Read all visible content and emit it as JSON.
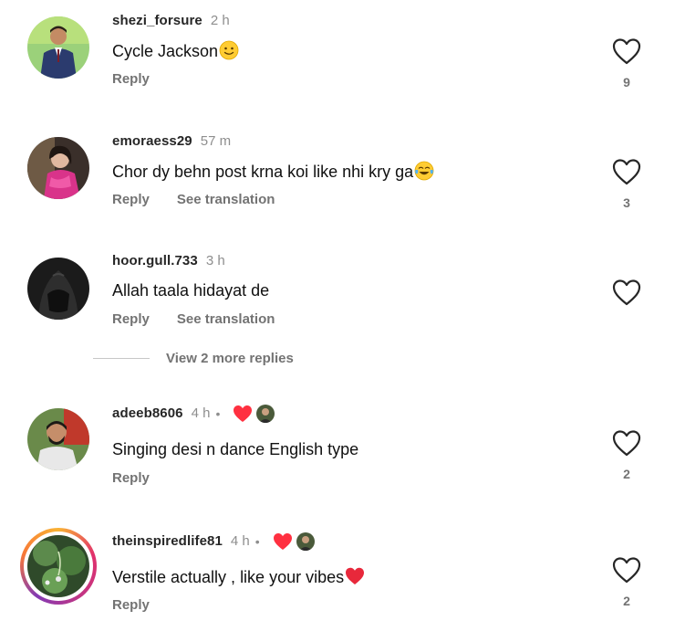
{
  "comments": [
    {
      "username": "shezi_forsure",
      "time": "2 h",
      "text": "Cycle Jackson",
      "emoji": "slightly-smiling-face",
      "reply_label": "Reply",
      "translation_label": "",
      "likes": "9",
      "avatar": "man-in-suit-avatar"
    },
    {
      "username": "emoraess29",
      "time": "57 m",
      "text": "Chor dy behn post krna koi like nhi kry ga",
      "emoji": "tears-of-joy-face",
      "reply_label": "Reply",
      "translation_label": "See translation",
      "likes": "3",
      "avatar": "girl-pink-dress-avatar"
    },
    {
      "username": "hoor.gull.733",
      "time": "3 h",
      "text": "Allah taala hidayat de",
      "emoji": "",
      "reply_label": "Reply",
      "translation_label": "See translation",
      "likes": "",
      "avatar": "dark-abaya-avatar"
    },
    {
      "username": "adeeb8606",
      "time": "4 h",
      "dot": "•",
      "creator_liked": true,
      "text": "Singing desi n dance English type",
      "emoji": "",
      "reply_label": "Reply",
      "translation_label": "",
      "likes": "2",
      "avatar": "bearded-man-avatar"
    },
    {
      "username": "theinspiredlife81",
      "time": "4 h",
      "dot": "•",
      "creator_liked": true,
      "text": "Verstile actually , like your vibes",
      "emoji": "red-heart",
      "reply_label": "Reply",
      "translation_label": "",
      "likes": "2",
      "avatar": "plant-photo-avatar",
      "has_story_ring": true
    }
  ],
  "view_more_replies": "View 2 more replies",
  "colors": {
    "username": "#262626",
    "secondary_text": "#737373",
    "timestamp": "#8e8e8e",
    "liked_heart": "#ff3040",
    "outline_heart": "#262626"
  }
}
